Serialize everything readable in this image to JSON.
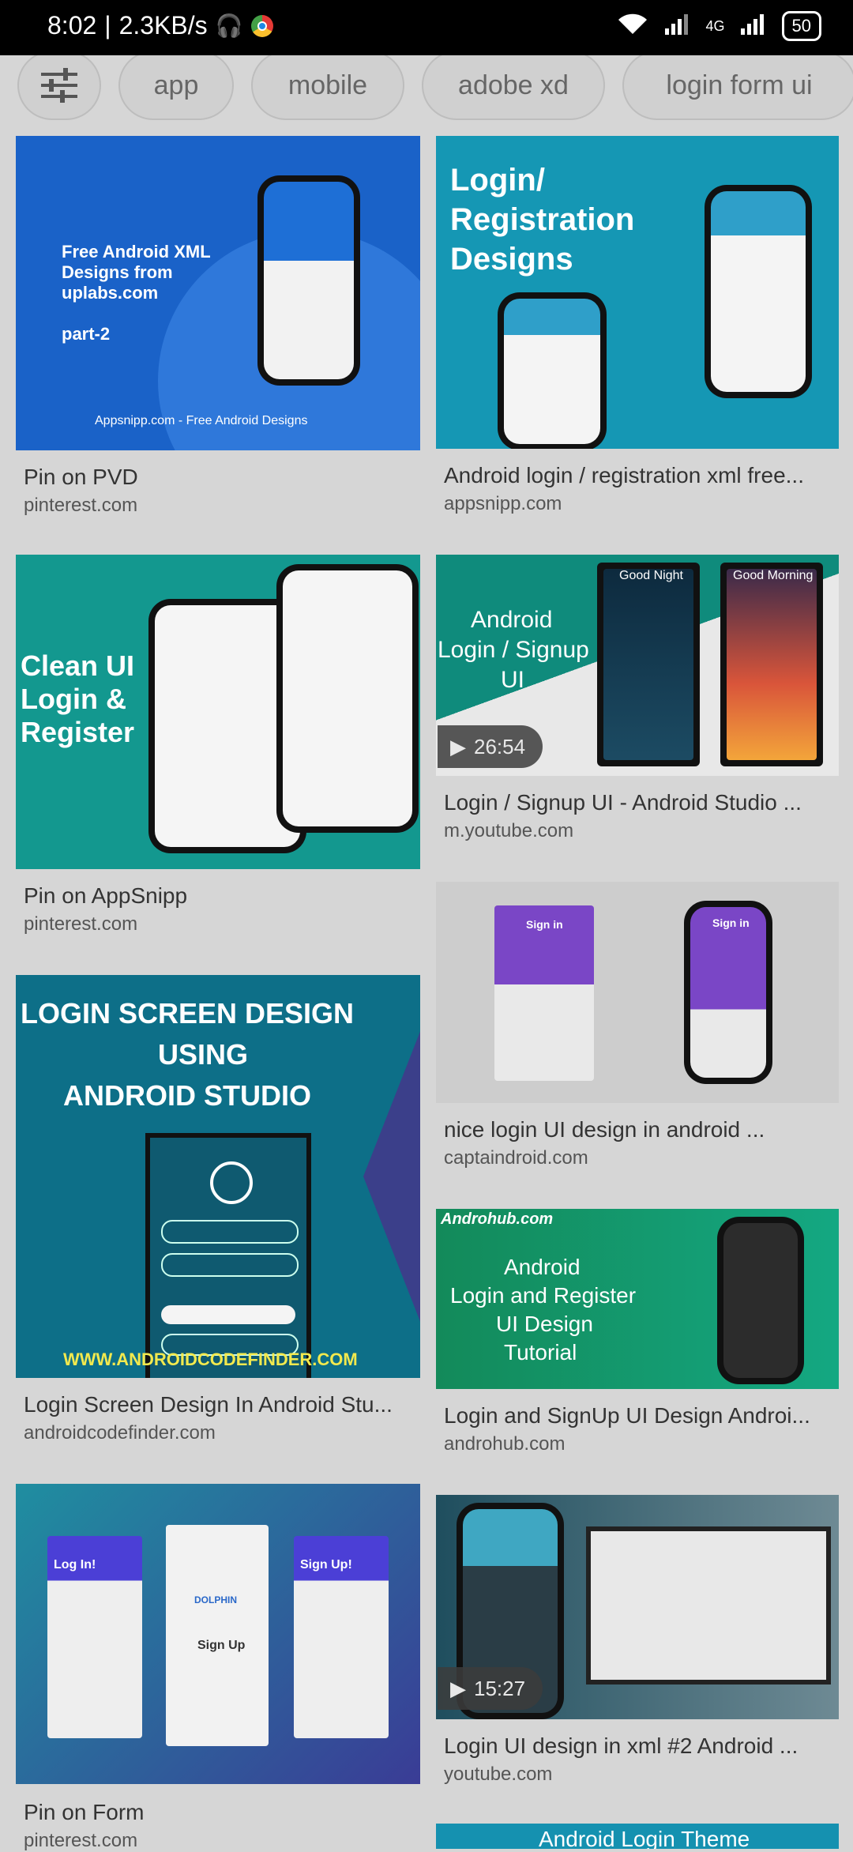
{
  "status_bar": {
    "time": "8:02",
    "speed": "2.3KB/s",
    "network": "4G",
    "battery": "50"
  },
  "chips": [
    "app",
    "mobile",
    "adobe xd",
    "login form ui"
  ],
  "results": [
    {
      "title": "Pin on PVD",
      "source": "pinterest.com",
      "thumb_text": [
        "Free Android XML",
        "Designs from",
        "uplabs.com",
        "part-2",
        "Appsnipp.com - Free Android Designs"
      ],
      "color": "#1a62c8"
    },
    {
      "title": "Android login / registration xml free...",
      "source": "appsnipp.com",
      "thumb_text": [
        "Login/",
        "Registration",
        "Designs"
      ],
      "color": "#1597b4"
    },
    {
      "title": "Pin on AppSnipp",
      "source": "pinterest.com",
      "thumb_text": [
        "Clean UI",
        "Login &",
        "Register"
      ],
      "color": "#13988f"
    },
    {
      "title": "Login / Signup UI - Android Studio ...",
      "source": "m.youtube.com",
      "duration": "26:54",
      "thumb_text": [
        "Android",
        "Login / Signup",
        "UI",
        "Good Night",
        "Good Morning"
      ],
      "color": "#0f8b7c"
    },
    {
      "title": "nice login UI design in android ...",
      "source": "captaindroid.com",
      "thumb_text": [
        "Sign in",
        "Sign in"
      ],
      "color": "#c9c9c9"
    },
    {
      "title": "Login Screen Design In Android Stu...",
      "source": "androidcodefinder.com",
      "thumb_text": [
        "LOGIN SCREEN DESIGN",
        "USING",
        "ANDROID STUDIO",
        "WWW.ANDROIDCODEFINDER.COM"
      ],
      "color": "#0d6f88"
    },
    {
      "title": "Login and SignUp UI Design Androi...",
      "source": "androhub.com",
      "thumb_text": [
        "Androhub.com",
        "Android",
        "Login and Register",
        "UI Design",
        "Tutorial"
      ],
      "color": "#138a5a"
    },
    {
      "title": "Pin on Form",
      "source": "pinterest.com",
      "thumb_text": [
        "Log In!",
        "Sign Up",
        "Sign Up!",
        "DOLPHIN"
      ],
      "color": "#1f8ea0"
    },
    {
      "title": "Login UI design in xml #2 Android ...",
      "source": "youtube.com",
      "duration": "15:27",
      "thumb_text": [],
      "color": "#2a6b7c"
    },
    {
      "title": "",
      "source": "",
      "thumb_text": [
        "Android Login Theme"
      ],
      "color": "#1591b0"
    }
  ]
}
